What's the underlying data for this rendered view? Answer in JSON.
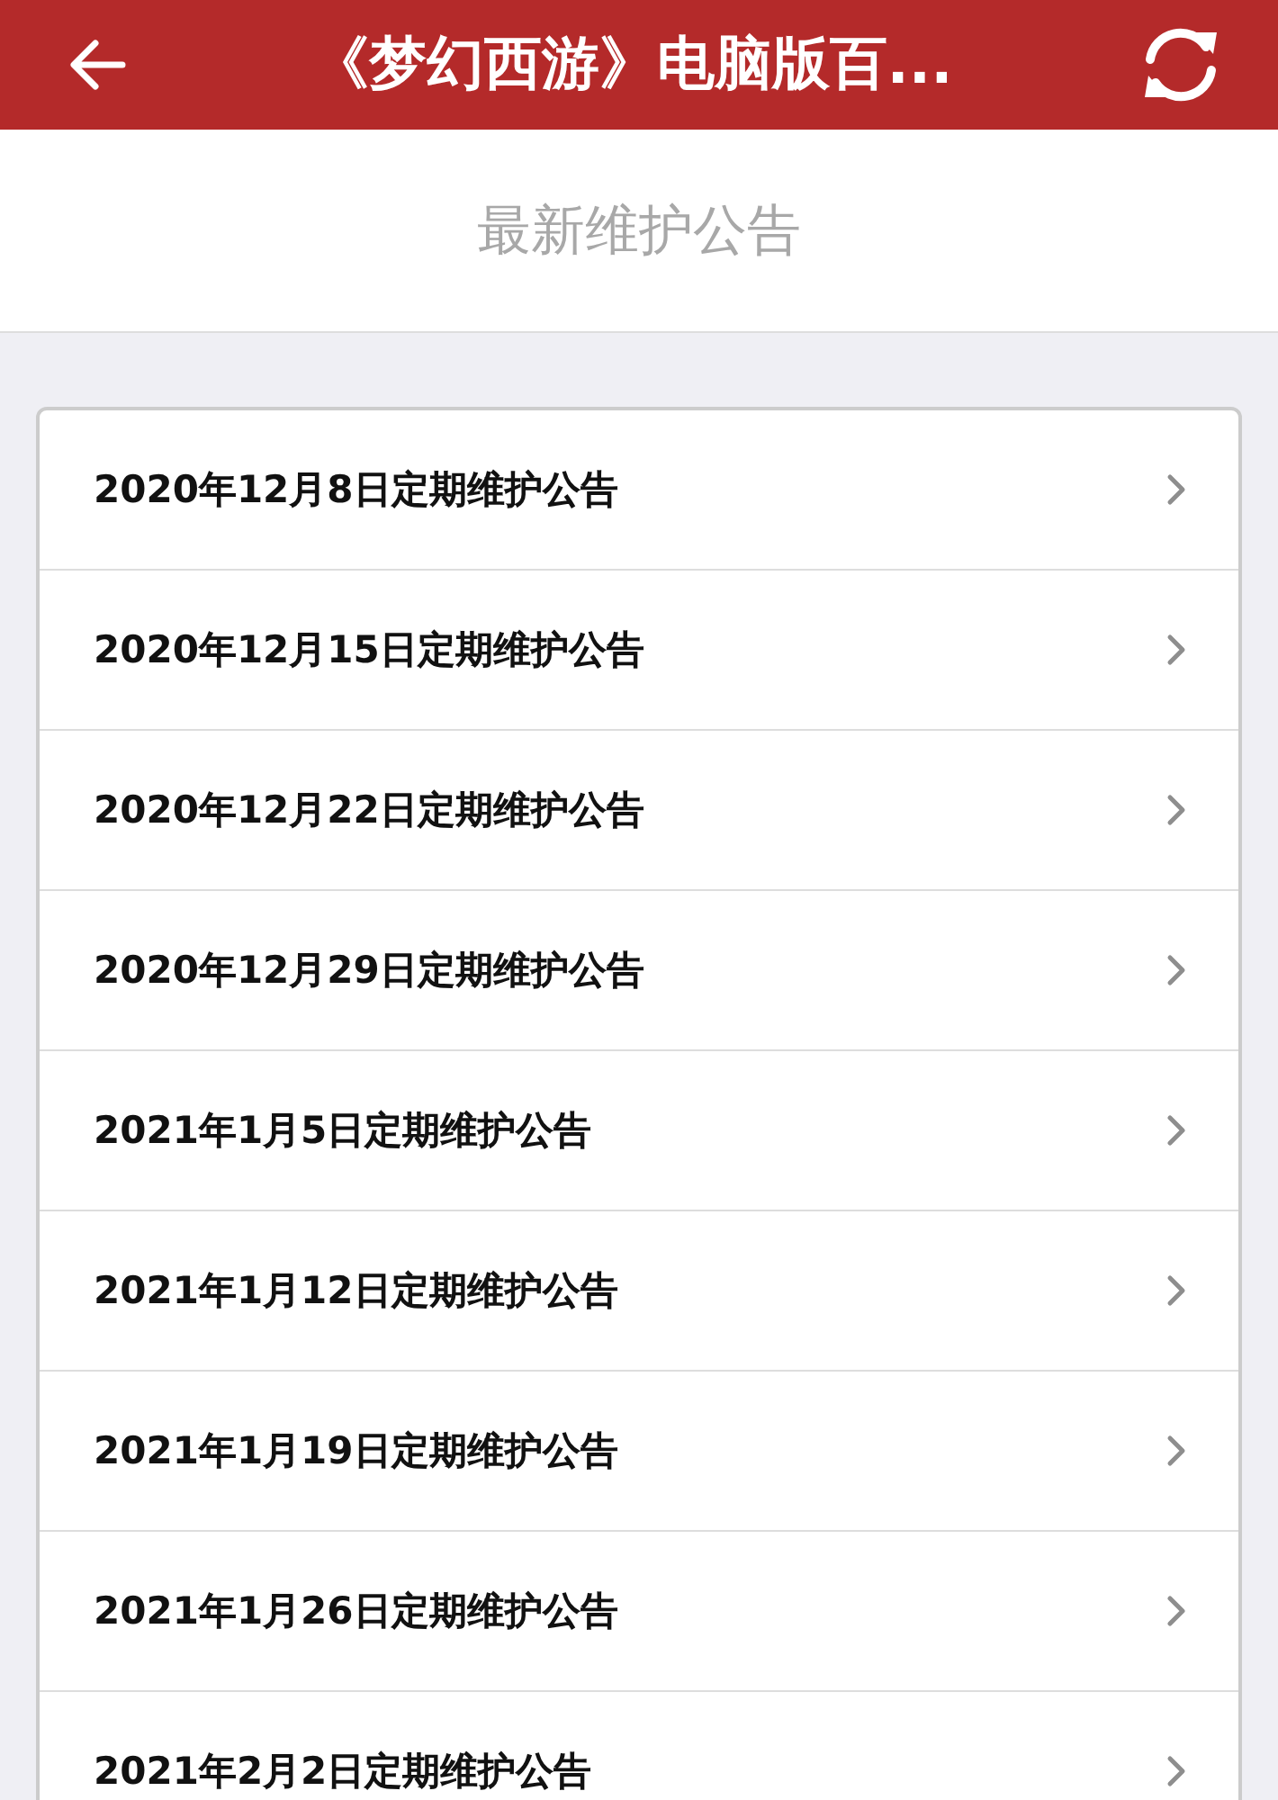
{
  "header": {
    "title": "《梦幻西游》电脑版百..."
  },
  "section_title": "最新维护公告",
  "notices": [
    {
      "title": "2020年12月8日定期维护公告"
    },
    {
      "title": "2020年12月15日定期维护公告"
    },
    {
      "title": "2020年12月22日定期维护公告"
    },
    {
      "title": "2020年12月29日定期维护公告"
    },
    {
      "title": "2021年1月5日定期维护公告"
    },
    {
      "title": "2021年1月12日定期维护公告"
    },
    {
      "title": "2021年1月19日定期维护公告"
    },
    {
      "title": "2021年1月26日定期维护公告"
    },
    {
      "title": "2021年2月2日定期维护公告"
    }
  ]
}
